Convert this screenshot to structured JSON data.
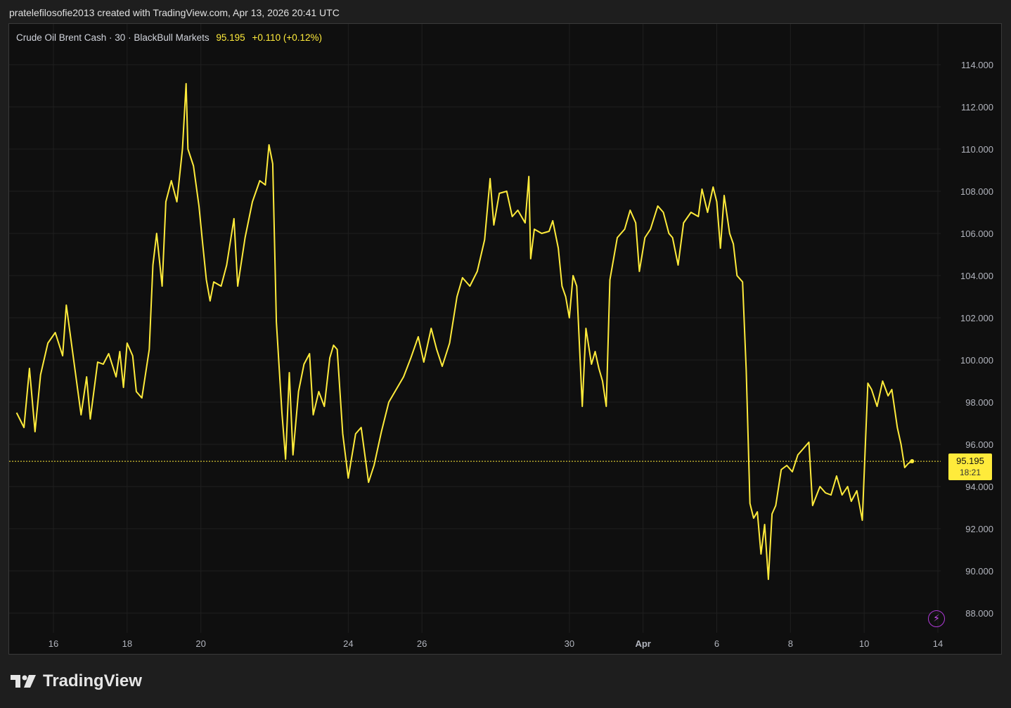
{
  "header": {
    "text": "pratelefilosofie2013 created with TradingView.com, Apr 13, 2026 20:41 UTC"
  },
  "legend": {
    "symbol": "Crude Oil Brent Cash · 30 · BlackBull Markets",
    "price": "95.195",
    "change": "+0.110 (+0.12%)"
  },
  "price_badge": {
    "price": "95.195",
    "countdown": "18:21"
  },
  "brand": {
    "name": "TradingView"
  },
  "colors": {
    "line": "#ffeb3b",
    "background": "#0f0f0f",
    "grid": "#1f1f1f",
    "axis_text": "#b2b5be",
    "bolt": "#c84ff0"
  },
  "icons": {
    "bolt": "lightning-icon",
    "logo": "tradingview-logo-icon"
  },
  "chart_data": {
    "type": "line",
    "title": "",
    "xlabel": "",
    "ylabel": "",
    "ylim": [
      87.0,
      115.0
    ],
    "y_ticks": [
      "114.000",
      "112.000",
      "110.000",
      "108.000",
      "106.000",
      "104.000",
      "102.000",
      "100.000",
      "98.000",
      "96.000",
      "94.000",
      "92.000",
      "90.000",
      "88.000"
    ],
    "x_ticks": [
      {
        "label": "16",
        "day": 16
      },
      {
        "label": "18",
        "day": 18
      },
      {
        "label": "20",
        "day": 20
      },
      {
        "label": "24",
        "day": 24
      },
      {
        "label": "26",
        "day": 26
      },
      {
        "label": "30",
        "day": 30
      },
      {
        "label": "Apr",
        "day": 32
      },
      {
        "label": "6",
        "day": 34
      },
      {
        "label": "8",
        "day": 36
      },
      {
        "label": "10",
        "day": 38
      },
      {
        "label": "14",
        "day": 40
      }
    ],
    "last_price": 95.195,
    "grid": true,
    "series": [
      {
        "values": [
          [
            15.0,
            97.5
          ],
          [
            15.2,
            96.8
          ],
          [
            15.35,
            99.6
          ],
          [
            15.5,
            96.6
          ],
          [
            15.65,
            99.3
          ],
          [
            15.85,
            100.8
          ],
          [
            16.05,
            101.3
          ],
          [
            16.25,
            100.2
          ],
          [
            16.35,
            102.6
          ],
          [
            16.55,
            100.0
          ],
          [
            16.75,
            97.4
          ],
          [
            16.9,
            99.2
          ],
          [
            17.0,
            97.2
          ],
          [
            17.2,
            99.9
          ],
          [
            17.35,
            99.8
          ],
          [
            17.5,
            100.3
          ],
          [
            17.7,
            99.2
          ],
          [
            17.8,
            100.4
          ],
          [
            17.9,
            98.7
          ],
          [
            18.0,
            100.8
          ],
          [
            18.15,
            100.2
          ],
          [
            18.25,
            98.5
          ],
          [
            18.4,
            98.2
          ],
          [
            18.6,
            100.5
          ],
          [
            18.7,
            104.5
          ],
          [
            18.8,
            106.0
          ],
          [
            18.95,
            103.5
          ],
          [
            19.05,
            107.5
          ],
          [
            19.2,
            108.5
          ],
          [
            19.35,
            107.5
          ],
          [
            19.5,
            110.0
          ],
          [
            19.6,
            113.1
          ],
          [
            19.65,
            110.0
          ],
          [
            19.8,
            109.2
          ],
          [
            19.95,
            107.3
          ],
          [
            20.05,
            105.5
          ],
          [
            20.15,
            103.8
          ],
          [
            20.25,
            102.8
          ],
          [
            20.35,
            103.7
          ],
          [
            20.55,
            103.5
          ],
          [
            20.7,
            104.5
          ],
          [
            20.9,
            106.7
          ],
          [
            21.0,
            103.5
          ],
          [
            21.2,
            105.8
          ],
          [
            21.4,
            107.5
          ],
          [
            21.6,
            108.5
          ],
          [
            21.75,
            108.3
          ],
          [
            21.85,
            110.2
          ],
          [
            21.95,
            109.3
          ],
          [
            22.05,
            101.8
          ],
          [
            22.2,
            97.5
          ],
          [
            22.3,
            95.3
          ],
          [
            22.4,
            99.4
          ],
          [
            22.5,
            95.5
          ],
          [
            22.65,
            98.5
          ],
          [
            22.8,
            99.8
          ],
          [
            22.95,
            100.3
          ],
          [
            23.05,
            97.4
          ],
          [
            23.2,
            98.5
          ],
          [
            23.35,
            97.8
          ],
          [
            23.5,
            100.1
          ],
          [
            23.6,
            100.7
          ],
          [
            23.7,
            100.5
          ],
          [
            23.85,
            96.5
          ],
          [
            24.0,
            94.4
          ],
          [
            24.2,
            96.5
          ],
          [
            24.35,
            96.8
          ],
          [
            24.55,
            94.2
          ],
          [
            24.7,
            95.0
          ],
          [
            24.9,
            96.6
          ],
          [
            25.1,
            98.0
          ],
          [
            25.3,
            98.6
          ],
          [
            25.5,
            99.2
          ],
          [
            25.7,
            100.1
          ],
          [
            25.9,
            101.1
          ],
          [
            26.05,
            99.9
          ],
          [
            26.25,
            101.5
          ],
          [
            26.4,
            100.5
          ],
          [
            26.55,
            99.7
          ],
          [
            26.75,
            100.8
          ],
          [
            26.95,
            103.0
          ],
          [
            27.1,
            103.9
          ],
          [
            27.3,
            103.5
          ],
          [
            27.5,
            104.2
          ],
          [
            27.7,
            105.7
          ],
          [
            27.85,
            108.6
          ],
          [
            27.95,
            106.4
          ],
          [
            28.1,
            107.9
          ],
          [
            28.3,
            108.0
          ],
          [
            28.45,
            106.8
          ],
          [
            28.6,
            107.1
          ],
          [
            28.8,
            106.5
          ],
          [
            28.9,
            108.7
          ],
          [
            28.95,
            104.8
          ],
          [
            29.05,
            106.2
          ],
          [
            29.25,
            106.0
          ],
          [
            29.45,
            106.1
          ],
          [
            29.55,
            106.6
          ],
          [
            29.7,
            105.3
          ],
          [
            29.8,
            103.5
          ],
          [
            29.9,
            103.0
          ],
          [
            30.0,
            102.0
          ],
          [
            30.1,
            104.0
          ],
          [
            30.2,
            103.5
          ],
          [
            30.35,
            97.8
          ],
          [
            30.45,
            101.5
          ],
          [
            30.6,
            99.8
          ],
          [
            30.7,
            100.4
          ],
          [
            30.8,
            99.6
          ],
          [
            30.9,
            99.0
          ],
          [
            31.0,
            97.8
          ],
          [
            31.1,
            103.8
          ],
          [
            31.3,
            105.8
          ],
          [
            31.5,
            106.2
          ],
          [
            31.65,
            107.1
          ],
          [
            31.8,
            106.5
          ],
          [
            31.9,
            104.2
          ],
          [
            32.05,
            105.8
          ],
          [
            32.2,
            106.2
          ],
          [
            32.4,
            107.3
          ],
          [
            32.55,
            107.0
          ],
          [
            32.7,
            106.0
          ],
          [
            32.8,
            105.8
          ],
          [
            32.95,
            104.5
          ],
          [
            33.1,
            106.5
          ],
          [
            33.3,
            107.0
          ],
          [
            33.5,
            106.8
          ],
          [
            33.6,
            108.1
          ],
          [
            33.75,
            107.0
          ],
          [
            33.9,
            108.2
          ],
          [
            34.0,
            107.5
          ],
          [
            34.1,
            105.3
          ],
          [
            34.2,
            107.8
          ],
          [
            34.35,
            106.0
          ],
          [
            34.45,
            105.5
          ],
          [
            34.55,
            104.0
          ],
          [
            34.7,
            103.7
          ],
          [
            34.8,
            99.5
          ],
          [
            34.9,
            93.2
          ],
          [
            35.0,
            92.5
          ],
          [
            35.1,
            92.8
          ],
          [
            35.2,
            90.8
          ],
          [
            35.3,
            92.2
          ],
          [
            35.4,
            89.6
          ],
          [
            35.5,
            92.7
          ],
          [
            35.6,
            93.1
          ],
          [
            35.75,
            94.8
          ],
          [
            35.9,
            95.0
          ],
          [
            36.05,
            94.7
          ],
          [
            36.2,
            95.5
          ],
          [
            36.35,
            95.8
          ],
          [
            36.5,
            96.1
          ],
          [
            36.6,
            93.1
          ],
          [
            36.8,
            94.0
          ],
          [
            36.95,
            93.7
          ],
          [
            37.1,
            93.6
          ],
          [
            37.25,
            94.5
          ],
          [
            37.4,
            93.6
          ],
          [
            37.55,
            94.0
          ],
          [
            37.65,
            93.3
          ],
          [
            37.8,
            93.8
          ],
          [
            37.95,
            92.4
          ],
          [
            38.1,
            98.9
          ],
          [
            38.2,
            98.6
          ],
          [
            38.35,
            97.8
          ],
          [
            38.5,
            99.0
          ],
          [
            38.65,
            98.3
          ],
          [
            38.75,
            98.6
          ],
          [
            38.9,
            96.8
          ],
          [
            39.0,
            96.0
          ],
          [
            39.1,
            94.9
          ],
          [
            39.2,
            95.1
          ],
          [
            39.3,
            95.2
          ]
        ]
      }
    ]
  }
}
